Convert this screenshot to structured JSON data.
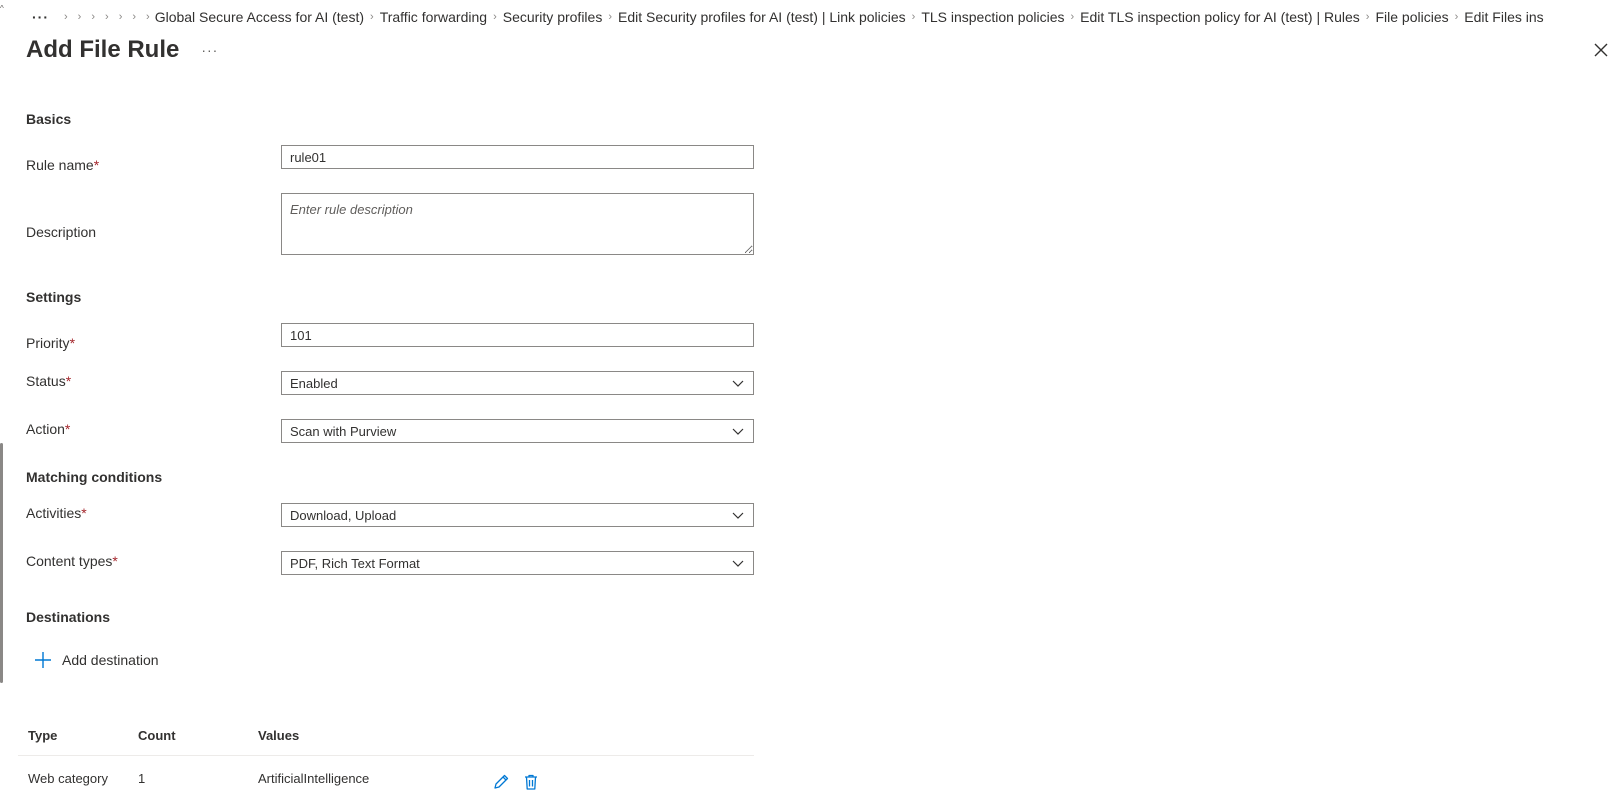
{
  "breadcrumb": {
    "items": [
      "Global Secure Access for AI (test)",
      "Traffic forwarding",
      "Security profiles",
      "Edit Security profiles for AI (test) | Link policies",
      "TLS inspection policies",
      "Edit TLS inspection policy for AI (test) | Rules",
      "File policies",
      "Edit Files ins"
    ]
  },
  "header": {
    "title": "Add File Rule",
    "more_label": "···"
  },
  "sections": {
    "basics": "Basics",
    "settings": "Settings",
    "matching": "Matching conditions",
    "destinations": "Destinations"
  },
  "fields": {
    "rule_name": {
      "label": "Rule name",
      "value": "rule01"
    },
    "description": {
      "label": "Description",
      "placeholder": "Enter rule description"
    },
    "priority": {
      "label": "Priority",
      "value": "101"
    },
    "status": {
      "label": "Status",
      "value": "Enabled"
    },
    "action": {
      "label": "Action",
      "value": "Scan with Purview"
    },
    "activities": {
      "label": "Activities",
      "value": "Download, Upload"
    },
    "content_types": {
      "label": "Content types",
      "value": "PDF, Rich Text Format"
    }
  },
  "required_marker": "*",
  "add_destination_label": "Add destination",
  "table": {
    "headers": {
      "type": "Type",
      "count": "Count",
      "values": "Values"
    },
    "rows": [
      {
        "type": "Web category",
        "count": "1",
        "values": "ArtificialIntelligence"
      }
    ]
  },
  "colors": {
    "accent": "#0078d4",
    "required": "#a4262c",
    "text": "#323130"
  }
}
